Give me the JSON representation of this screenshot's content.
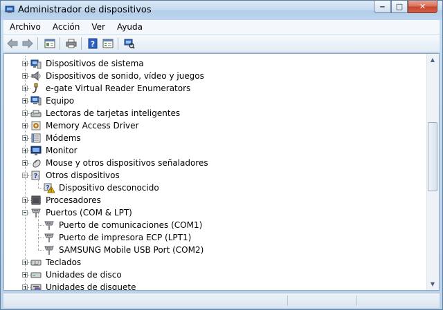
{
  "window": {
    "title": "Administrador de dispositivos"
  },
  "window_buttons": {
    "minimize": "‒",
    "maximize": "□",
    "close": "✕"
  },
  "menu": [
    "Archivo",
    "Acción",
    "Ver",
    "Ayuda"
  ],
  "toolbar": [
    "back-icon",
    "forward-icon",
    "properties-icon",
    "print-icon",
    "help-icon",
    "view-icon",
    "scan-hardware-icon"
  ],
  "tree": [
    {
      "label": "Dispositivos de sistema",
      "icon": "system-devices-icon",
      "level": 0,
      "expander": "plus"
    },
    {
      "label": "Dispositivos de sonido, vídeo y juegos",
      "icon": "speaker-icon",
      "level": 0,
      "expander": "plus"
    },
    {
      "label": "e-gate Virtual Reader Enumerators",
      "icon": "plug-icon",
      "level": 0,
      "expander": "plus"
    },
    {
      "label": "Equipo",
      "icon": "computer-icon",
      "level": 0,
      "expander": "plus"
    },
    {
      "label": "Lectoras de tarjetas inteligentes",
      "icon": "card-reader-icon",
      "level": 0,
      "expander": "plus"
    },
    {
      "label": "Memory Access Driver",
      "icon": "driver-icon",
      "level": 0,
      "expander": "plus"
    },
    {
      "label": "Módems",
      "icon": "modem-icon",
      "level": 0,
      "expander": "plus"
    },
    {
      "label": "Monitor",
      "icon": "monitor-icon",
      "level": 0,
      "expander": "plus"
    },
    {
      "label": "Mouse y otros dispositivos señaladores",
      "icon": "mouse-icon",
      "level": 0,
      "expander": "plus"
    },
    {
      "label": "Otros dispositivos",
      "icon": "unknown-device-icon",
      "level": 0,
      "expander": "minus"
    },
    {
      "label": "Dispositivo desconocido",
      "icon": "warning-device-icon",
      "level": 1,
      "expander": "none"
    },
    {
      "label": "Procesadores",
      "icon": "processor-icon",
      "level": 0,
      "expander": "plus"
    },
    {
      "label": "Puertos (COM & LPT)",
      "icon": "port-icon",
      "level": 0,
      "expander": "minus"
    },
    {
      "label": "Puerto de comunicaciones (COM1)",
      "icon": "port-icon",
      "level": 1,
      "expander": "none"
    },
    {
      "label": "Puerto de impresora ECP (LPT1)",
      "icon": "port-icon",
      "level": 1,
      "expander": "none"
    },
    {
      "label": "SAMSUNG Mobile USB Port (COM2)",
      "icon": "port-icon",
      "level": 1,
      "expander": "none"
    },
    {
      "label": "Teclados",
      "icon": "keyboard-icon",
      "level": 0,
      "expander": "plus"
    },
    {
      "label": "Unidades de disco",
      "icon": "disk-drive-icon",
      "level": 0,
      "expander": "plus"
    },
    {
      "label": "Unidades de disquete",
      "icon": "floppy-drive-icon",
      "level": 0,
      "expander": "plus"
    }
  ],
  "scrollbar": {
    "up": "▲",
    "down": "▼"
  },
  "colors": {
    "title_gradient": "#c4daf0",
    "close_button": "#c8442a",
    "tree_line": "#a0a0a0",
    "warning": "#f4c400"
  }
}
